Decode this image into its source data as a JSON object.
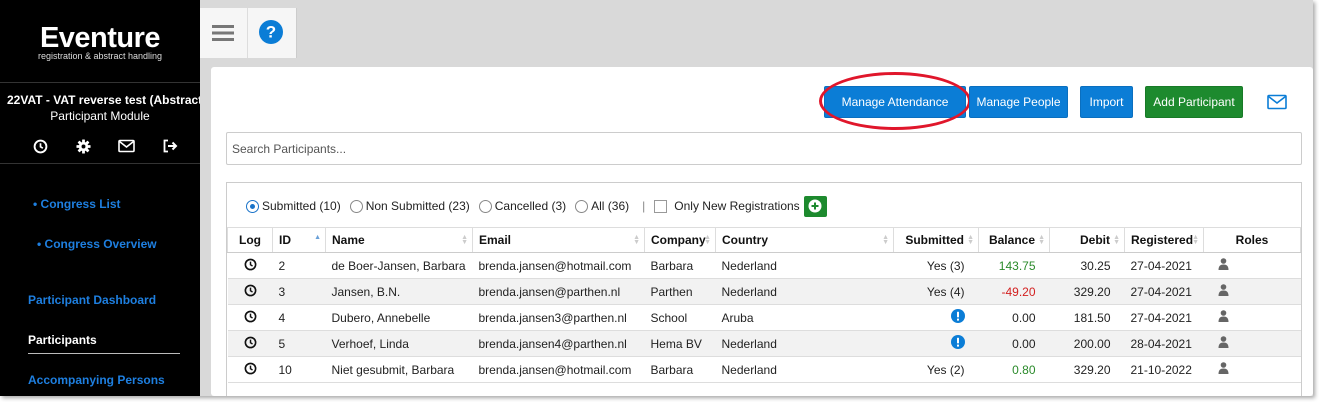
{
  "app": {
    "logo_main": "Eventure",
    "logo_sub": "registration & abstract handling",
    "event_title": "22VAT - VAT reverse test (Abstract...",
    "module_name": "Participant Module"
  },
  "sidebar": {
    "icons": [
      "clock-icon",
      "gear-icon",
      "envelope-icon",
      "logout-icon"
    ],
    "items": [
      {
        "label": "• Congress List"
      },
      {
        "label": "• Congress Overview"
      },
      {
        "label": "Participant Dashboard"
      },
      {
        "label": "Participants",
        "active": true
      },
      {
        "label": "Accompanying Persons"
      }
    ]
  },
  "toolbar": {
    "manage_attendance": "Manage Attendance",
    "manage_people": "Manage People",
    "import": "Import",
    "add_participant": "Add Participant"
  },
  "search": {
    "placeholder": "Search Participants..."
  },
  "filters": {
    "submitted": "Submitted (10)",
    "non_submitted": "Non Submitted (23)",
    "cancelled": "Cancelled (3)",
    "all": "All (36)",
    "only_new": "Only New Registrations",
    "selected": "submitted"
  },
  "table": {
    "columns": [
      "Log",
      "ID",
      "Name",
      "Email",
      "Company",
      "Country",
      "Submitted",
      "Balance",
      "Debit",
      "Registered",
      "Roles"
    ],
    "rows": [
      {
        "id": "2",
        "name": "de Boer-Jansen, Barbara",
        "email": "brenda.jansen@hotmail.com",
        "company": "Barbara",
        "country": "Nederland",
        "submitted": "Yes (3)",
        "balance": "143.75",
        "balance_sign": "pos",
        "debit": "30.25",
        "registered": "27-04-2021"
      },
      {
        "id": "3",
        "name": "Jansen, B.N.",
        "email": "brenda.jansen@parthen.nl",
        "company": "Parthen",
        "country": "Nederland",
        "submitted": "Yes (4)",
        "balance": "-49.20",
        "balance_sign": "neg",
        "debit": "329.20",
        "registered": "27-04-2021"
      },
      {
        "id": "4",
        "name": "Dubero, Annebelle",
        "email": "brenda.jansen3@parthen.nl",
        "company": "School",
        "country": "Aruba",
        "submitted": "",
        "balance": "0.00",
        "balance_sign": "zero",
        "debit": "181.50",
        "registered": "27-04-2021"
      },
      {
        "id": "5",
        "name": "Verhoef, Linda",
        "email": "brenda.jansen4@parthen.nl",
        "company": "Hema BV",
        "country": "Nederland",
        "submitted": "",
        "balance": "0.00",
        "balance_sign": "zero",
        "debit": "200.00",
        "registered": "28-04-2021"
      },
      {
        "id": "10",
        "name": "Niet gesubmit, Barbara",
        "email": "brenda.jansen@hotmail.com",
        "company": "Barbara",
        "country": "Nederland",
        "submitted": "Yes (2)",
        "balance": "0.80",
        "balance_sign": "pos",
        "debit": "329.20",
        "registered": "21-10-2022"
      }
    ]
  },
  "colors": {
    "primary": "#0b7dd6",
    "success": "#1d8a2e",
    "danger": "#d32020",
    "highlight": "#e0162b"
  }
}
